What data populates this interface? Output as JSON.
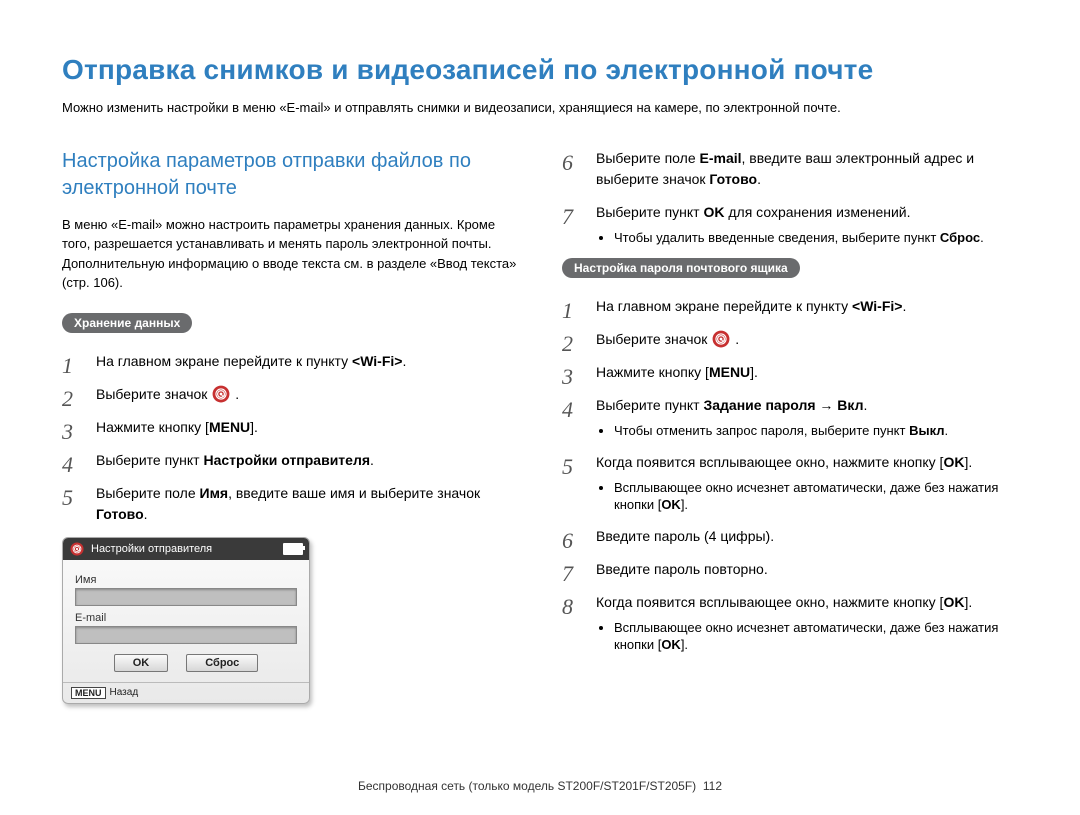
{
  "title": "Отправка снимков и видеозаписей по электронной почте",
  "intro": "Можно изменить настройки в меню «E-mail» и отправлять снимки и видеозаписи, хранящиеся на камере, по электронной почте.",
  "left": {
    "section": "Настройка параметров отправки файлов по электронной почте",
    "para": "В меню «E-mail» можно настроить параметры хранения данных. Кроме того, разрешается устанавливать и менять пароль электронной почты. Дополнительную информацию о вводе текста см. в разделе «Ввод текста» (стр. 106).",
    "pill": "Хранение данных",
    "steps": {
      "s1_a": "На главном экране перейдите к пункту ",
      "s1_b": "<Wi-Fi>",
      "s1_c": ".",
      "s2": "Выберите значок ",
      "s3_a": "Нажмите кнопку [",
      "s3_menu": "MENU",
      "s3_b": "].",
      "s4_a": "Выберите пункт ",
      "s4_b": "Настройки отправителя",
      "s4_c": ".",
      "s5_a": "Выберите поле ",
      "s5_b": "Имя",
      "s5_c": ", введите ваше имя и выберите значок ",
      "s5_d": "Готово",
      "s5_e": "."
    },
    "device": {
      "title": "Настройки отправителя",
      "label_name": "Имя",
      "label_email": "E-mail",
      "btn_ok": "OK",
      "btn_reset": "Сброс",
      "footer_menu": "MENU",
      "footer_back": "Назад"
    }
  },
  "right": {
    "pre_steps": {
      "s6_a": "Выберите поле ",
      "s6_b": "E-mail",
      "s6_c": ", введите ваш электронный адрес и выберите значок ",
      "s6_d": "Готово",
      "s6_e": ".",
      "s7_a": "Выберите пункт ",
      "s7_b": "OK",
      "s7_c": " для сохранения изменений.",
      "s7_bullet_a": "Чтобы удалить введенные сведения, выберите пункт ",
      "s7_bullet_b": "Сброс",
      "s7_bullet_c": "."
    },
    "pill": "Настройка пароля почтового ящика",
    "steps": {
      "s1_a": "На главном экране перейдите к пункту ",
      "s1_b": "<Wi-Fi>",
      "s1_c": ".",
      "s2": "Выберите значок ",
      "s3_a": "Нажмите кнопку [",
      "s3_menu": "MENU",
      "s3_b": "].",
      "s4_a": "Выберите пункт ",
      "s4_b": "Задание пароля",
      "s4_c": " → ",
      "s4_d": "Вкл",
      "s4_e": ".",
      "s4_bullet_a": "Чтобы отменить запрос пароля, выберите пункт ",
      "s4_bullet_b": "Выкл",
      "s4_bullet_c": ".",
      "s5_a": "Когда появится всплывающее окно, нажмите кнопку [",
      "s5_ok": "OK",
      "s5_b": "].",
      "s5_bullet_a": "Всплывающее окно исчезнет автоматически, даже без нажатия кнопки [",
      "s5_bullet_ok": "OK",
      "s5_bullet_b": "].",
      "s6": "Введите пароль (4 цифры).",
      "s7": "Введите пароль повторно.",
      "s8_a": "Когда появится всплывающее окно, нажмите кнопку [",
      "s8_ok": "OK",
      "s8_b": "].",
      "s8_bullet_a": "Всплывающее окно исчезнет автоматически, даже без нажатия кнопки [",
      "s8_bullet_ok": "OK",
      "s8_bullet_b": "]."
    }
  },
  "footer": {
    "text": "Беспроводная сеть  (только модель ST200F/ST201F/ST205F)",
    "page": "112"
  }
}
